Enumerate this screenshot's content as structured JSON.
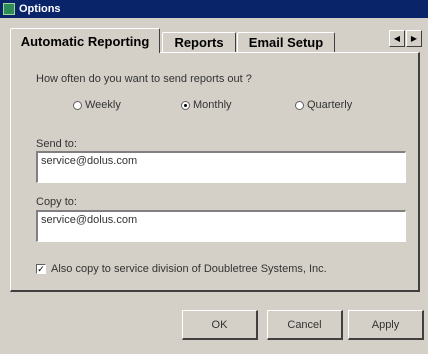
{
  "window": {
    "title": "Options"
  },
  "tabs": [
    {
      "label": "Automatic Reporting",
      "active": true
    },
    {
      "label": "Reports",
      "active": false
    },
    {
      "label": "Email Setup",
      "active": false
    }
  ],
  "tab_scroll": {
    "left_icon": "chevron-left-icon",
    "right_icon": "chevron-right-icon",
    "left_glyph": "◀",
    "right_glyph": "▶"
  },
  "frequency": {
    "question": "How often do you want to send reports out ?",
    "options": [
      {
        "label": "Weekly",
        "checked": false
      },
      {
        "label": "Monthly",
        "checked": true
      },
      {
        "label": "Quarterly",
        "checked": false
      }
    ]
  },
  "send_to": {
    "label": "Send to:",
    "value": "service@dolus.com"
  },
  "copy_to": {
    "label": "Copy to:",
    "value": "service@dolus.com"
  },
  "also_copy": {
    "label": "Also copy to service division of Doubletree Systems, Inc.",
    "checked": true,
    "mark": "✓"
  },
  "buttons": {
    "ok": "OK",
    "cancel": "Cancel",
    "apply": "Apply"
  },
  "colors": {
    "titlebar": "#0a246a",
    "face": "#d4d0c8"
  }
}
